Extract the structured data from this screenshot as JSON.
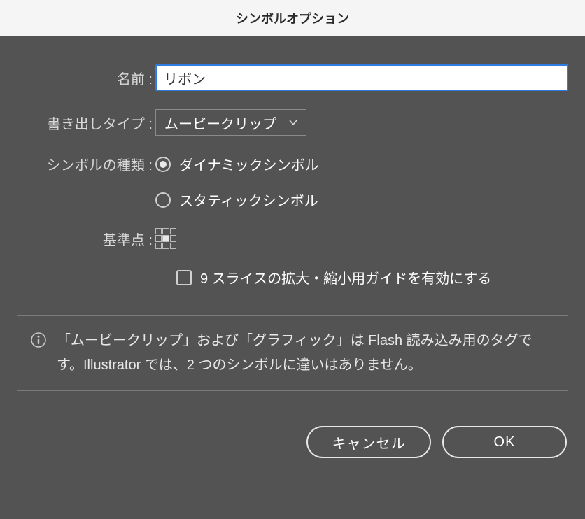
{
  "dialog": {
    "title": "シンボルオプション"
  },
  "form": {
    "name_label": "名前 :",
    "name_value": "リボン",
    "export_type_label": "書き出しタイプ :",
    "export_type_value": "ムービークリップ",
    "symbol_type_label": "シンボルの種類 :",
    "radio_dynamic": "ダイナミックシンボル",
    "radio_static": "スタティックシンボル",
    "registration_label": "基準点 :",
    "nine_slice_label": "9 スライスの拡大・縮小用ガイドを有効にする"
  },
  "info": {
    "text": "「ムービークリップ」および「グラフィック」は Flash 読み込み用のタグです。Illustrator では、2 つのシンボルに違いはありません。"
  },
  "buttons": {
    "cancel": "キャンセル",
    "ok": "OK"
  }
}
